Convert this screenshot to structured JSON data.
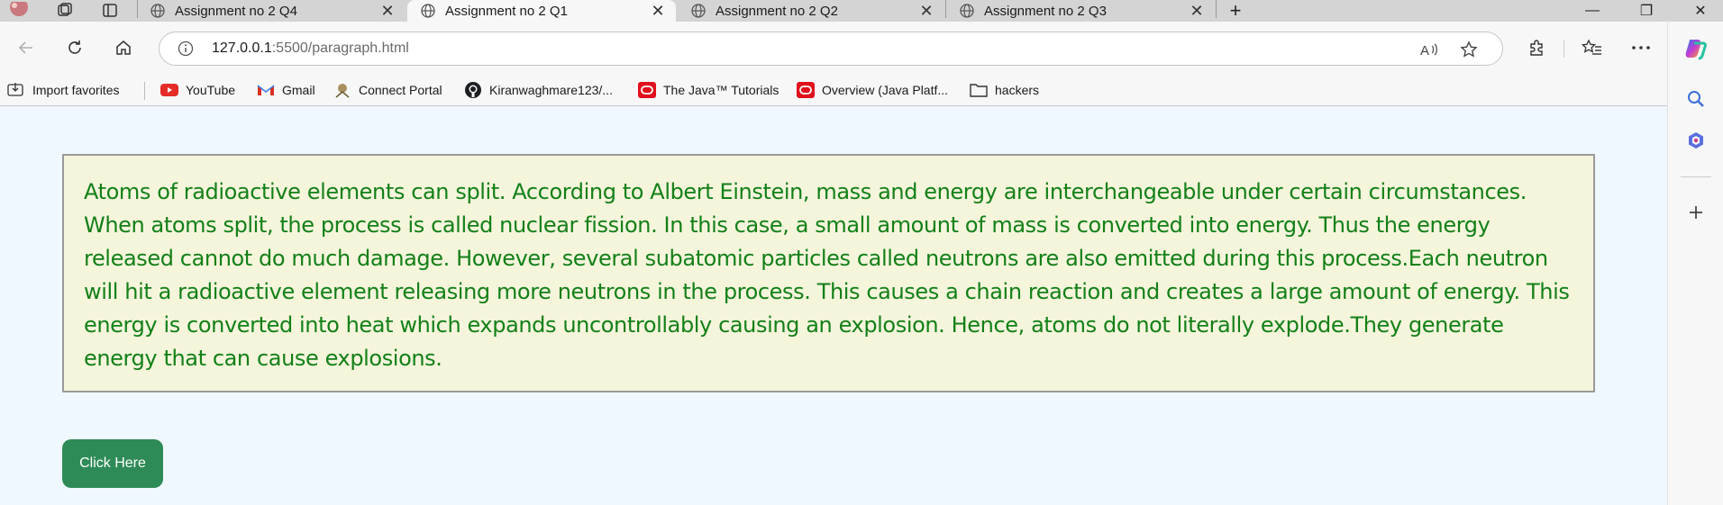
{
  "tabs": [
    {
      "title": "Assignment no 2 Q4",
      "active": false
    },
    {
      "title": "Assignment no 2 Q1",
      "active": true
    },
    {
      "title": "Assignment no 2 Q2",
      "active": false
    },
    {
      "title": "Assignment no 2 Q3",
      "active": false
    }
  ],
  "tab_close_glyph": "✕",
  "new_tab_glyph": "+",
  "window": {
    "minimize": "—",
    "restore": "❐",
    "close": "✕"
  },
  "address": {
    "host": "127.0.0.1",
    "rest": ":5500/paragraph.html"
  },
  "favorites": [
    {
      "label": "Import favorites",
      "icon": "import-icon"
    },
    {
      "label": "YouTube",
      "icon": "youtube-icon"
    },
    {
      "label": "Gmail",
      "icon": "gmail-icon"
    },
    {
      "label": "Connect Portal",
      "icon": "portal-icon"
    },
    {
      "label": "Kiranwaghmare123/...",
      "icon": "github-icon"
    },
    {
      "label": "The Java™ Tutorials",
      "icon": "oracle-icon"
    },
    {
      "label": "Overview (Java Platf...",
      "icon": "oracle-icon"
    },
    {
      "label": "hackers",
      "icon": "folder-icon"
    }
  ],
  "page": {
    "paragraph": "Atoms of radioactive elements can split. According to Albert Einstein, mass and energy are interchangeable under certain circumstances. When atoms split, the process is called nuclear fission. In this case, a small amount of mass is converted into energy. Thus the energy released cannot do much damage. However, several subatomic particles called neutrons are also emitted during this process.Each neutron will hit a radioactive element releasing more neutrons in the process. This causes a chain reaction and creates a large amount of energy. This energy is converted into heat which expands uncontrollably causing an explosion. Hence, atoms do not literally explode.They generate energy that can cause explosions.",
    "button_label": "Click Here"
  },
  "colors": {
    "page_bg": "#f0f8ff",
    "box_bg": "#f5f5dc",
    "text_green": "#138017",
    "button_bg": "#2e8b57"
  }
}
